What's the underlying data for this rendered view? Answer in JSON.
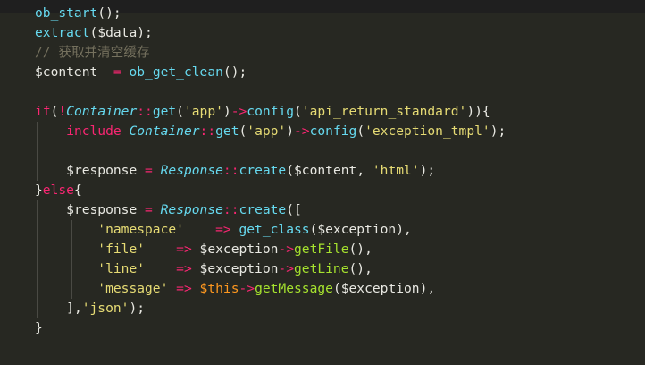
{
  "theme": {
    "background": "#272822",
    "topbar": "#1f1f1f",
    "plain": "#e8e8e2",
    "function": "#66d9ef",
    "keyword": "#f92672",
    "string": "#e6db74",
    "comment": "#75715e",
    "method": "#a6e22e",
    "this": "#fd971f"
  },
  "code_lines": [
    {
      "indent": 0,
      "tokens": [
        {
          "t": "ob_start",
          "k": "fn"
        },
        {
          "t": "();",
          "k": "punct"
        }
      ]
    },
    {
      "indent": 0,
      "tokens": [
        {
          "t": "extract",
          "k": "fn"
        },
        {
          "t": "(",
          "k": "punct"
        },
        {
          "t": "$data",
          "k": "var"
        },
        {
          "t": ");",
          "k": "punct"
        }
      ]
    },
    {
      "indent": 0,
      "tokens": [
        {
          "t": "// 获取并清空缓存",
          "k": "comment"
        }
      ]
    },
    {
      "indent": 0,
      "tokens": [
        {
          "t": "$content",
          "k": "var"
        },
        {
          "t": "  ",
          "k": "punct"
        },
        {
          "t": "=",
          "k": "op"
        },
        {
          "t": " ",
          "k": "punct"
        },
        {
          "t": "ob_get_clean",
          "k": "fn"
        },
        {
          "t": "();",
          "k": "punct"
        }
      ]
    },
    {
      "indent": 0,
      "tokens": []
    },
    {
      "indent": 0,
      "tokens": [
        {
          "t": "if",
          "k": "keyword"
        },
        {
          "t": "(",
          "k": "punct"
        },
        {
          "t": "!",
          "k": "op"
        },
        {
          "t": "Container",
          "k": "class"
        },
        {
          "t": "::",
          "k": "op"
        },
        {
          "t": "get",
          "k": "funcname"
        },
        {
          "t": "(",
          "k": "punct"
        },
        {
          "t": "'app'",
          "k": "str"
        },
        {
          "t": ")",
          "k": "punct"
        },
        {
          "t": "->",
          "k": "op"
        },
        {
          "t": "config",
          "k": "funcname"
        },
        {
          "t": "(",
          "k": "punct"
        },
        {
          "t": "'api_return_standard'",
          "k": "str"
        },
        {
          "t": ")){",
          "k": "punct"
        }
      ]
    },
    {
      "indent": 1,
      "tokens": [
        {
          "t": "    ",
          "k": "punct"
        },
        {
          "t": "include",
          "k": "keyword"
        },
        {
          "t": " ",
          "k": "punct"
        },
        {
          "t": "Container",
          "k": "class"
        },
        {
          "t": "::",
          "k": "op"
        },
        {
          "t": "get",
          "k": "funcname"
        },
        {
          "t": "(",
          "k": "punct"
        },
        {
          "t": "'app'",
          "k": "str"
        },
        {
          "t": ")",
          "k": "punct"
        },
        {
          "t": "->",
          "k": "op"
        },
        {
          "t": "config",
          "k": "funcname"
        },
        {
          "t": "(",
          "k": "punct"
        },
        {
          "t": "'exception_tmpl'",
          "k": "str"
        },
        {
          "t": ");",
          "k": "punct"
        }
      ]
    },
    {
      "indent": 1,
      "tokens": []
    },
    {
      "indent": 1,
      "tokens": [
        {
          "t": "    ",
          "k": "punct"
        },
        {
          "t": "$response",
          "k": "var"
        },
        {
          "t": " ",
          "k": "punct"
        },
        {
          "t": "=",
          "k": "op"
        },
        {
          "t": " ",
          "k": "punct"
        },
        {
          "t": "Response",
          "k": "class"
        },
        {
          "t": "::",
          "k": "op"
        },
        {
          "t": "create",
          "k": "funcname"
        },
        {
          "t": "(",
          "k": "punct"
        },
        {
          "t": "$content",
          "k": "var"
        },
        {
          "t": ", ",
          "k": "punct"
        },
        {
          "t": "'html'",
          "k": "str"
        },
        {
          "t": ");",
          "k": "punct"
        }
      ]
    },
    {
      "indent": 0,
      "tokens": [
        {
          "t": "}",
          "k": "punct"
        },
        {
          "t": "else",
          "k": "keyword"
        },
        {
          "t": "{",
          "k": "punct"
        }
      ]
    },
    {
      "indent": 1,
      "tokens": [
        {
          "t": "    ",
          "k": "punct"
        },
        {
          "t": "$response",
          "k": "var"
        },
        {
          "t": " ",
          "k": "punct"
        },
        {
          "t": "=",
          "k": "op"
        },
        {
          "t": " ",
          "k": "punct"
        },
        {
          "t": "Response",
          "k": "class"
        },
        {
          "t": "::",
          "k": "op"
        },
        {
          "t": "create",
          "k": "funcname"
        },
        {
          "t": "([",
          "k": "punct"
        }
      ]
    },
    {
      "indent": 2,
      "tokens": [
        {
          "t": "        ",
          "k": "punct"
        },
        {
          "t": "'namespace'",
          "k": "str"
        },
        {
          "t": "    ",
          "k": "punct"
        },
        {
          "t": "=>",
          "k": "op"
        },
        {
          "t": " ",
          "k": "punct"
        },
        {
          "t": "get_class",
          "k": "fn"
        },
        {
          "t": "(",
          "k": "punct"
        },
        {
          "t": "$exception",
          "k": "var"
        },
        {
          "t": "),",
          "k": "punct"
        }
      ]
    },
    {
      "indent": 2,
      "tokens": [
        {
          "t": "        ",
          "k": "punct"
        },
        {
          "t": "'file'",
          "k": "str"
        },
        {
          "t": "    ",
          "k": "punct"
        },
        {
          "t": "=>",
          "k": "op"
        },
        {
          "t": " ",
          "k": "punct"
        },
        {
          "t": "$exception",
          "k": "var"
        },
        {
          "t": "->",
          "k": "op"
        },
        {
          "t": "getFile",
          "k": "method"
        },
        {
          "t": "(),",
          "k": "punct"
        }
      ]
    },
    {
      "indent": 2,
      "tokens": [
        {
          "t": "        ",
          "k": "punct"
        },
        {
          "t": "'line'",
          "k": "str"
        },
        {
          "t": "    ",
          "k": "punct"
        },
        {
          "t": "=>",
          "k": "op"
        },
        {
          "t": " ",
          "k": "punct"
        },
        {
          "t": "$exception",
          "k": "var"
        },
        {
          "t": "->",
          "k": "op"
        },
        {
          "t": "getLine",
          "k": "method"
        },
        {
          "t": "(),",
          "k": "punct"
        }
      ]
    },
    {
      "indent": 2,
      "tokens": [
        {
          "t": "        ",
          "k": "punct"
        },
        {
          "t": "'message'",
          "k": "str"
        },
        {
          "t": " ",
          "k": "punct"
        },
        {
          "t": "=>",
          "k": "op"
        },
        {
          "t": " ",
          "k": "punct"
        },
        {
          "t": "$this",
          "k": "this"
        },
        {
          "t": "->",
          "k": "op"
        },
        {
          "t": "getMessage",
          "k": "method"
        },
        {
          "t": "(",
          "k": "punct"
        },
        {
          "t": "$exception",
          "k": "var"
        },
        {
          "t": "),",
          "k": "punct"
        }
      ]
    },
    {
      "indent": 1,
      "tokens": [
        {
          "t": "    ",
          "k": "punct"
        },
        {
          "t": "],",
          "k": "punct"
        },
        {
          "t": "'json'",
          "k": "str"
        },
        {
          "t": ");",
          "k": "punct"
        }
      ]
    },
    {
      "indent": 0,
      "tokens": [
        {
          "t": "}",
          "k": "punct"
        }
      ]
    }
  ]
}
